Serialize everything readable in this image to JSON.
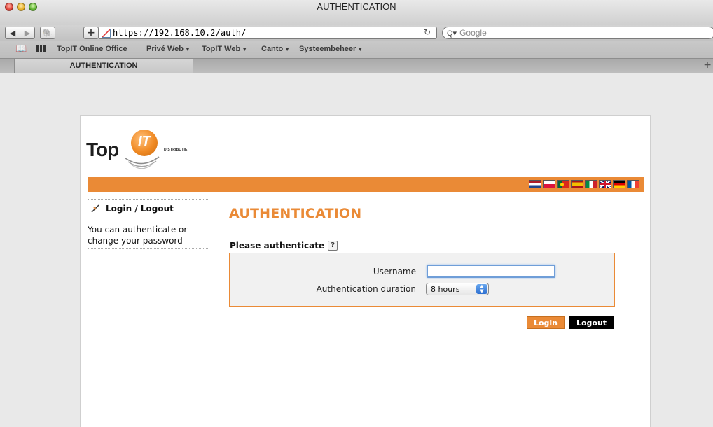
{
  "window": {
    "title": "AUTHENTICATION"
  },
  "toolbar": {
    "url": "https://192.168.10.2/auth/",
    "search_placeholder": "Google",
    "reload_glyph": "↻"
  },
  "bookmarks": [
    {
      "label": "TopIT Online Office",
      "has_menu": false
    },
    {
      "label": "Privé Web",
      "has_menu": true
    },
    {
      "label": "TopIT Web",
      "has_menu": true
    },
    {
      "label": "Canto",
      "has_menu": true
    },
    {
      "label": "Systeembeheer",
      "has_menu": true
    }
  ],
  "tab": {
    "label": "AUTHENTICATION"
  },
  "logo": {
    "word": "Top",
    "ball_text": "IT",
    "tagline": "DISTRIBUTIE"
  },
  "colors": {
    "accent": "#ea8a36",
    "logout_bg": "#000000",
    "input_focus": "#6f9ed8"
  },
  "languages": [
    "nl-flag-icon",
    "pl-flag-icon",
    "pt-flag-icon",
    "es-flag-icon",
    "it-flag-icon",
    "uk-flag-icon",
    "de-flag-icon",
    "fr-flag-icon"
  ],
  "sidebar": {
    "heading": "Login / Logout",
    "description": "You can authenticate or change your password"
  },
  "main": {
    "title": "AUTHENTICATION",
    "form_heading": "Please authenticate",
    "help_glyph": "?",
    "username_label": "Username",
    "username_value": "",
    "duration_label": "Authentication duration",
    "duration_value": "8 hours",
    "login_label": "Login",
    "logout_label": "Logout"
  }
}
